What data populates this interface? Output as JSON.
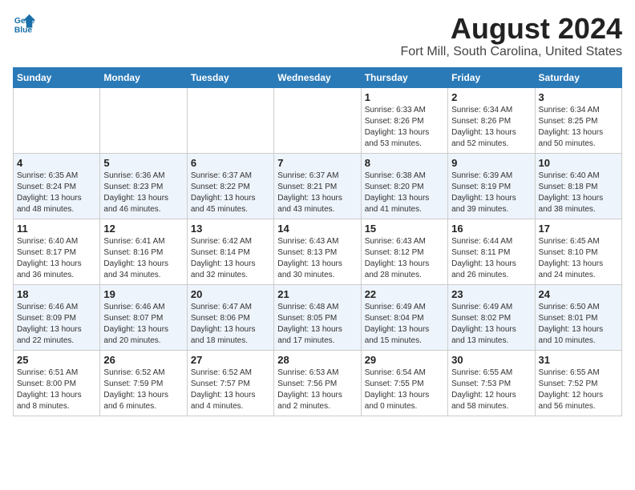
{
  "header": {
    "logo_line1": "General",
    "logo_line2": "Blue",
    "main_title": "August 2024",
    "subtitle": "Fort Mill, South Carolina, United States"
  },
  "days_of_week": [
    "Sunday",
    "Monday",
    "Tuesday",
    "Wednesday",
    "Thursday",
    "Friday",
    "Saturday"
  ],
  "weeks": [
    [
      {
        "day": "",
        "info": ""
      },
      {
        "day": "",
        "info": ""
      },
      {
        "day": "",
        "info": ""
      },
      {
        "day": "",
        "info": ""
      },
      {
        "day": "1",
        "info": "Sunrise: 6:33 AM\nSunset: 8:26 PM\nDaylight: 13 hours\nand 53 minutes."
      },
      {
        "day": "2",
        "info": "Sunrise: 6:34 AM\nSunset: 8:26 PM\nDaylight: 13 hours\nand 52 minutes."
      },
      {
        "day": "3",
        "info": "Sunrise: 6:34 AM\nSunset: 8:25 PM\nDaylight: 13 hours\nand 50 minutes."
      }
    ],
    [
      {
        "day": "4",
        "info": "Sunrise: 6:35 AM\nSunset: 8:24 PM\nDaylight: 13 hours\nand 48 minutes."
      },
      {
        "day": "5",
        "info": "Sunrise: 6:36 AM\nSunset: 8:23 PM\nDaylight: 13 hours\nand 46 minutes."
      },
      {
        "day": "6",
        "info": "Sunrise: 6:37 AM\nSunset: 8:22 PM\nDaylight: 13 hours\nand 45 minutes."
      },
      {
        "day": "7",
        "info": "Sunrise: 6:37 AM\nSunset: 8:21 PM\nDaylight: 13 hours\nand 43 minutes."
      },
      {
        "day": "8",
        "info": "Sunrise: 6:38 AM\nSunset: 8:20 PM\nDaylight: 13 hours\nand 41 minutes."
      },
      {
        "day": "9",
        "info": "Sunrise: 6:39 AM\nSunset: 8:19 PM\nDaylight: 13 hours\nand 39 minutes."
      },
      {
        "day": "10",
        "info": "Sunrise: 6:40 AM\nSunset: 8:18 PM\nDaylight: 13 hours\nand 38 minutes."
      }
    ],
    [
      {
        "day": "11",
        "info": "Sunrise: 6:40 AM\nSunset: 8:17 PM\nDaylight: 13 hours\nand 36 minutes."
      },
      {
        "day": "12",
        "info": "Sunrise: 6:41 AM\nSunset: 8:16 PM\nDaylight: 13 hours\nand 34 minutes."
      },
      {
        "day": "13",
        "info": "Sunrise: 6:42 AM\nSunset: 8:14 PM\nDaylight: 13 hours\nand 32 minutes."
      },
      {
        "day": "14",
        "info": "Sunrise: 6:43 AM\nSunset: 8:13 PM\nDaylight: 13 hours\nand 30 minutes."
      },
      {
        "day": "15",
        "info": "Sunrise: 6:43 AM\nSunset: 8:12 PM\nDaylight: 13 hours\nand 28 minutes."
      },
      {
        "day": "16",
        "info": "Sunrise: 6:44 AM\nSunset: 8:11 PM\nDaylight: 13 hours\nand 26 minutes."
      },
      {
        "day": "17",
        "info": "Sunrise: 6:45 AM\nSunset: 8:10 PM\nDaylight: 13 hours\nand 24 minutes."
      }
    ],
    [
      {
        "day": "18",
        "info": "Sunrise: 6:46 AM\nSunset: 8:09 PM\nDaylight: 13 hours\nand 22 minutes."
      },
      {
        "day": "19",
        "info": "Sunrise: 6:46 AM\nSunset: 8:07 PM\nDaylight: 13 hours\nand 20 minutes."
      },
      {
        "day": "20",
        "info": "Sunrise: 6:47 AM\nSunset: 8:06 PM\nDaylight: 13 hours\nand 18 minutes."
      },
      {
        "day": "21",
        "info": "Sunrise: 6:48 AM\nSunset: 8:05 PM\nDaylight: 13 hours\nand 17 minutes."
      },
      {
        "day": "22",
        "info": "Sunrise: 6:49 AM\nSunset: 8:04 PM\nDaylight: 13 hours\nand 15 minutes."
      },
      {
        "day": "23",
        "info": "Sunrise: 6:49 AM\nSunset: 8:02 PM\nDaylight: 13 hours\nand 13 minutes."
      },
      {
        "day": "24",
        "info": "Sunrise: 6:50 AM\nSunset: 8:01 PM\nDaylight: 13 hours\nand 10 minutes."
      }
    ],
    [
      {
        "day": "25",
        "info": "Sunrise: 6:51 AM\nSunset: 8:00 PM\nDaylight: 13 hours\nand 8 minutes."
      },
      {
        "day": "26",
        "info": "Sunrise: 6:52 AM\nSunset: 7:59 PM\nDaylight: 13 hours\nand 6 minutes."
      },
      {
        "day": "27",
        "info": "Sunrise: 6:52 AM\nSunset: 7:57 PM\nDaylight: 13 hours\nand 4 minutes."
      },
      {
        "day": "28",
        "info": "Sunrise: 6:53 AM\nSunset: 7:56 PM\nDaylight: 13 hours\nand 2 minutes."
      },
      {
        "day": "29",
        "info": "Sunrise: 6:54 AM\nSunset: 7:55 PM\nDaylight: 13 hours\nand 0 minutes."
      },
      {
        "day": "30",
        "info": "Sunrise: 6:55 AM\nSunset: 7:53 PM\nDaylight: 12 hours\nand 58 minutes."
      },
      {
        "day": "31",
        "info": "Sunrise: 6:55 AM\nSunset: 7:52 PM\nDaylight: 12 hours\nand 56 minutes."
      }
    ]
  ]
}
